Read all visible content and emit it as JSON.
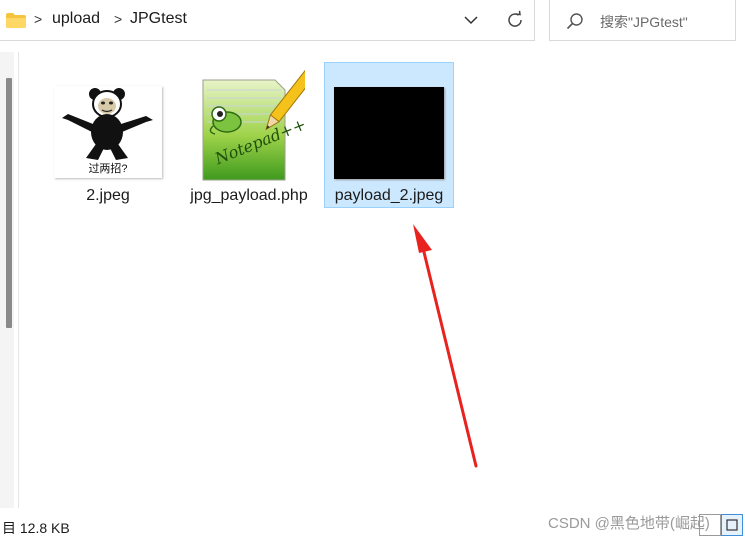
{
  "address_bar": {
    "breadcrumbs": [
      "upload",
      "JPGtest"
    ],
    "separator": ">",
    "icons": [
      "folder-icon",
      "chevron-down-icon",
      "refresh-icon"
    ]
  },
  "search": {
    "placeholder": "搜索\"JPGtest\"",
    "icon": "search-icon"
  },
  "files": [
    {
      "name": "2.jpeg",
      "thumb_caption": "过两招?",
      "selected": false
    },
    {
      "name": "jpg_payload.php",
      "selected": false
    },
    {
      "name": "payload_2.jpeg",
      "selected": true
    }
  ],
  "status_bar": {
    "text": "目 12.8 KB"
  },
  "watermark": "CSDN @黑色地带(崛起)",
  "colors": {
    "selection": "#cce8ff",
    "selection_border": "#99d1ff",
    "annotation_arrow": "#e8231f"
  }
}
